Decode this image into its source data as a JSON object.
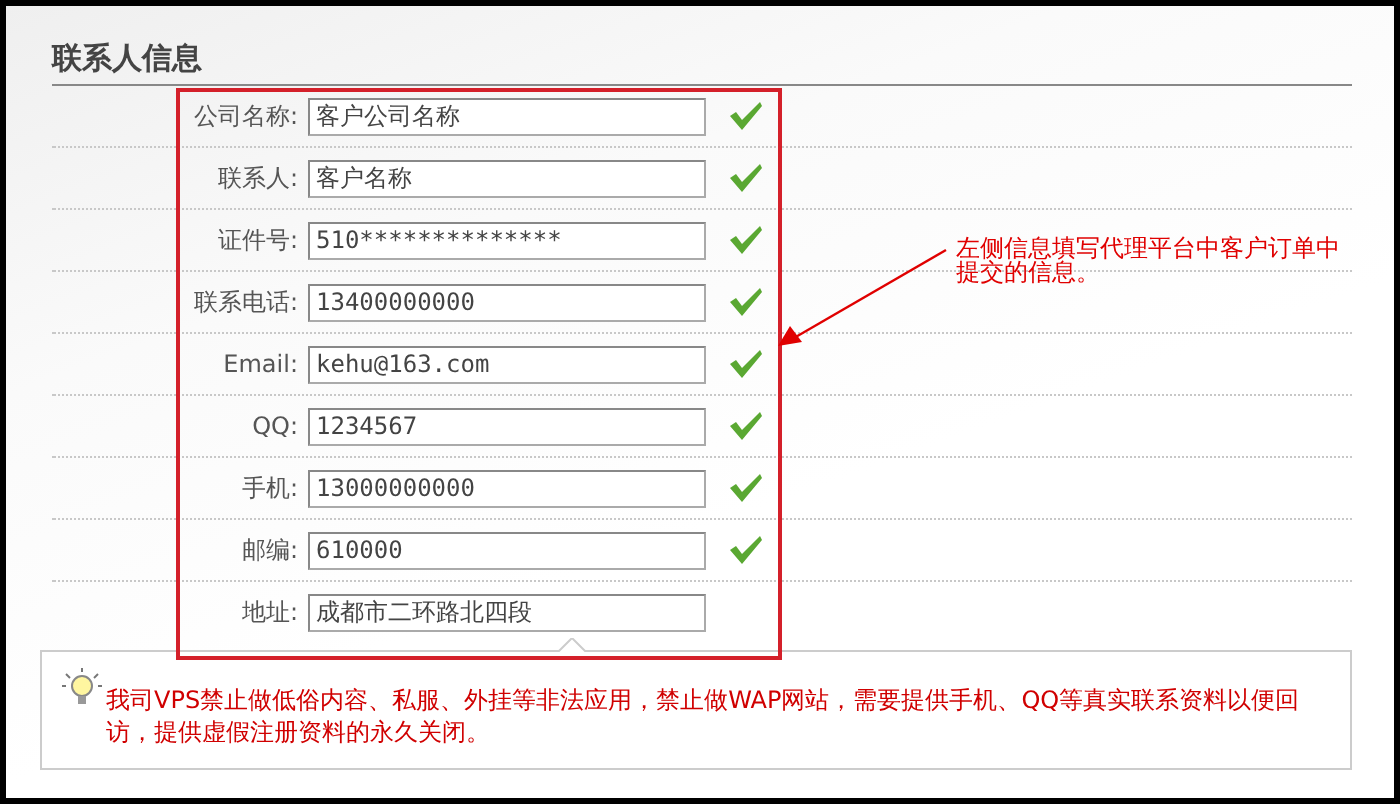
{
  "section": {
    "title": "联系人信息"
  },
  "fields": [
    {
      "label": "公司名称:",
      "value": "客户公司名称",
      "valid": true
    },
    {
      "label": "联系人:",
      "value": "客户名称",
      "valid": true
    },
    {
      "label": "证件号:",
      "value": "510**************",
      "valid": true
    },
    {
      "label": "联系电话:",
      "value": "13400000000",
      "valid": true
    },
    {
      "label": "Email:",
      "value": "kehu@163.com",
      "valid": true
    },
    {
      "label": "QQ:",
      "value": "1234567",
      "valid": true
    },
    {
      "label": "手机:",
      "value": "13000000000",
      "valid": true
    },
    {
      "label": "邮编:",
      "value": "610000",
      "valid": true
    },
    {
      "label": "地址:",
      "value": "成都市二环路北四段",
      "valid": false
    }
  ],
  "annotation": {
    "text": "左侧信息填写代理平台中客户订单中提交的信息。"
  },
  "notice": {
    "text": "我司VPS禁止做低俗内容、私服、外挂等非法应用，禁止做WAP网站，需要提供手机、QQ等真实联系资料以便回访，提供虚假注册资料的永久关闭。"
  }
}
